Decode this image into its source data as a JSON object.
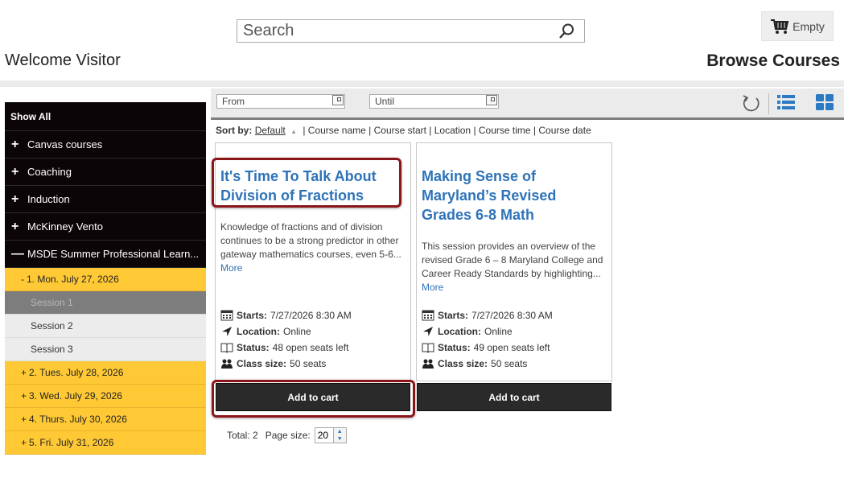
{
  "search": {
    "placeholder": "Search"
  },
  "cart": {
    "label": "Empty"
  },
  "header": {
    "welcome": "Welcome Visitor",
    "title": "Browse Courses"
  },
  "sidebar": {
    "show_all": "Show All",
    "categories": [
      {
        "sign": "+",
        "label": "Canvas courses"
      },
      {
        "sign": "+",
        "label": "Coaching"
      },
      {
        "sign": "+",
        "label": "Induction"
      },
      {
        "sign": "+",
        "label": "McKinney Vento"
      },
      {
        "sign": "—",
        "label": "MSDE Summer Professional Learn..."
      }
    ],
    "days": [
      {
        "sign": "-",
        "label": "1. Mon. July 27, 2026"
      },
      {
        "sign": "+",
        "label": "2. Tues. July 28, 2026"
      },
      {
        "sign": "+",
        "label": "3. Wed. July 29, 2026"
      },
      {
        "sign": "+",
        "label": "4. Thurs. July 30, 2026"
      },
      {
        "sign": "+",
        "label": "5. Fri. July 31, 2026"
      }
    ],
    "sessions": [
      "Session 1",
      "Session 2",
      "Session 3"
    ]
  },
  "filters": {
    "from": "From",
    "until": "Until"
  },
  "sort": {
    "label": "Sort by:",
    "default": "Default",
    "triangle": "▲",
    "options": "| Course name | Course start | Location | Course time | Course date"
  },
  "courses": [
    {
      "title": "It's Time To Talk About Division of Fractions",
      "description": "Knowledge of fractions and of division continues to be a strong predictor in other gateway mathematics courses, even 5-6...",
      "more": "More",
      "starts_label": "Starts:",
      "starts": "7/27/2026 8:30 AM",
      "location_label": "Location:",
      "location": "Online",
      "status_label": "Status:",
      "status": "48 open seats left",
      "size_label": "Class size:",
      "size": "50 seats",
      "add": "Add to cart"
    },
    {
      "title": "Making Sense of Maryland’s Revised Grades 6-8 Math",
      "description": "This session provides an overview of the revised Grade 6 – 8 Maryland College and Career Ready Standards by highlighting...",
      "more": "More",
      "starts_label": "Starts:",
      "starts": "7/27/2026 8:30 AM",
      "location_label": "Location:",
      "location": "Online",
      "status_label": "Status:",
      "status": "49 open seats left",
      "size_label": "Class size:",
      "size": "50 seats",
      "add": "Add to cart"
    }
  ],
  "footer": {
    "total": "Total: 2",
    "page_size_label": "Page size:",
    "page_size": "20"
  },
  "colors": {
    "sidebar_black": "#0c0507",
    "sidebar_yellow": "#ffc936",
    "link_blue": "#2e73b8",
    "highlight": "#8b1519",
    "button_dark": "#2a2a2a"
  }
}
